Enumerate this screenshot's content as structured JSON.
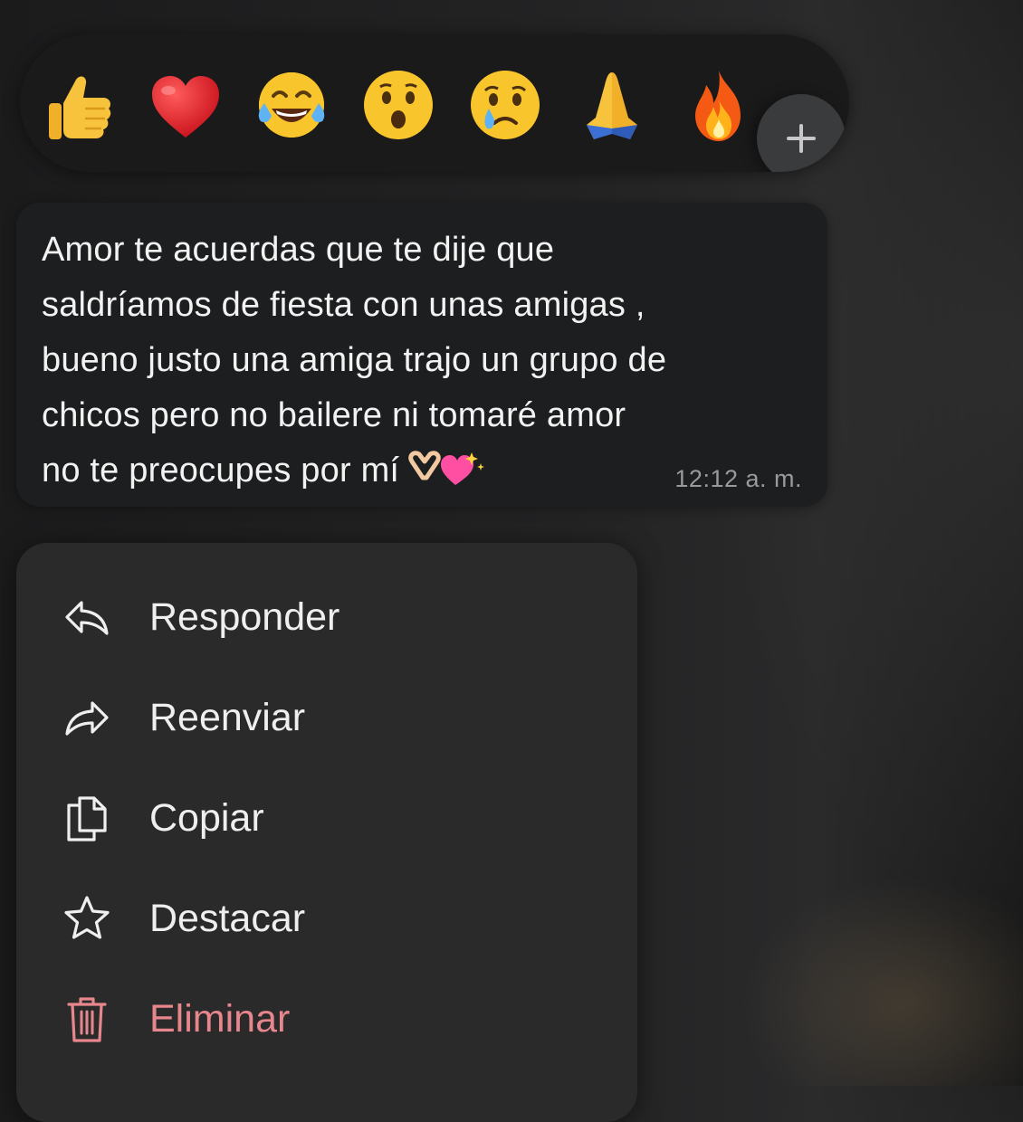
{
  "reactions": [
    {
      "name": "thumbs-up",
      "emoji": "👍"
    },
    {
      "name": "red-heart",
      "emoji": "❤️"
    },
    {
      "name": "tears-of-joy",
      "emoji": "😂"
    },
    {
      "name": "surprised-face",
      "emoji": "😮"
    },
    {
      "name": "crying-face",
      "emoji": "😢"
    },
    {
      "name": "folded-hands",
      "emoji": "🙏"
    },
    {
      "name": "fire",
      "emoji": "🔥"
    }
  ],
  "add_reaction_icon": "plus-icon",
  "message": {
    "lines": [
      "Amor te acuerdas que te dije que",
      "saldríamos de fiesta con unas amigas ,",
      "bueno justo una amiga trajo un grupo de",
      "chicos pero no bailere ni tomaré amor",
      "no te preocupes por mí"
    ],
    "trailing_emojis": "🫶💖",
    "time": "12:12 a. m."
  },
  "menu": {
    "items": [
      {
        "label": "Responder",
        "icon": "reply-icon"
      },
      {
        "label": "Reenviar",
        "icon": "forward-icon"
      },
      {
        "label": "Copiar",
        "icon": "copy-icon"
      },
      {
        "label": "Destacar",
        "icon": "star-icon"
      },
      {
        "label": "Eliminar",
        "icon": "trash-icon"
      }
    ]
  },
  "colors": {
    "danger": "#e8868d",
    "bubble": "#1d1e1f",
    "menu": "#2a2a2b"
  }
}
